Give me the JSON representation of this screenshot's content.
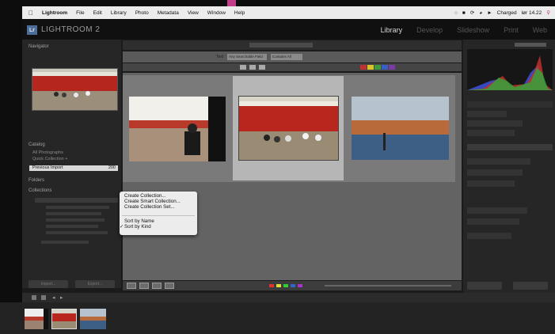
{
  "menubar": {
    "apple": "",
    "app_name": "Lightroom",
    "items": [
      "File",
      "Edit",
      "Library",
      "Photo",
      "Metadata",
      "View",
      "Window",
      "Help"
    ],
    "status": {
      "battery": "Charged",
      "datetime": "lør 14.22"
    }
  },
  "window": {
    "brand_badge": "Lr",
    "brand_name": "LIGHTROOM 2",
    "modules": [
      "Library",
      "Develop",
      "Slideshow",
      "Print",
      "Web"
    ],
    "active_module": "Library"
  },
  "left_panel": {
    "navigator_label": "Navigator",
    "catalog_label": "Catalog",
    "catalog_items": [
      "All Photographs",
      "Quick Collection +",
      "Previous Import"
    ],
    "previous_import_count": "200",
    "folders_label": "Folders",
    "collections_label": "Collections",
    "buttons": [
      "Import...",
      "Export..."
    ]
  },
  "context_menu": {
    "items": [
      "Create Collection...",
      "Create Smart Collection...",
      "Create Collection Set...",
      "Sort by Name",
      "Sort by Kind"
    ],
    "checked_item": "Sort by Kind"
  },
  "filter_bar": {
    "text_label": "Text",
    "text_value": "Any Searchable Field",
    "contains_value": "Contains All"
  },
  "colors": {
    "accent_pink": "#c23c8a",
    "lr_blue": "#4c6d99",
    "selected_cell": "#b6b6b6"
  }
}
